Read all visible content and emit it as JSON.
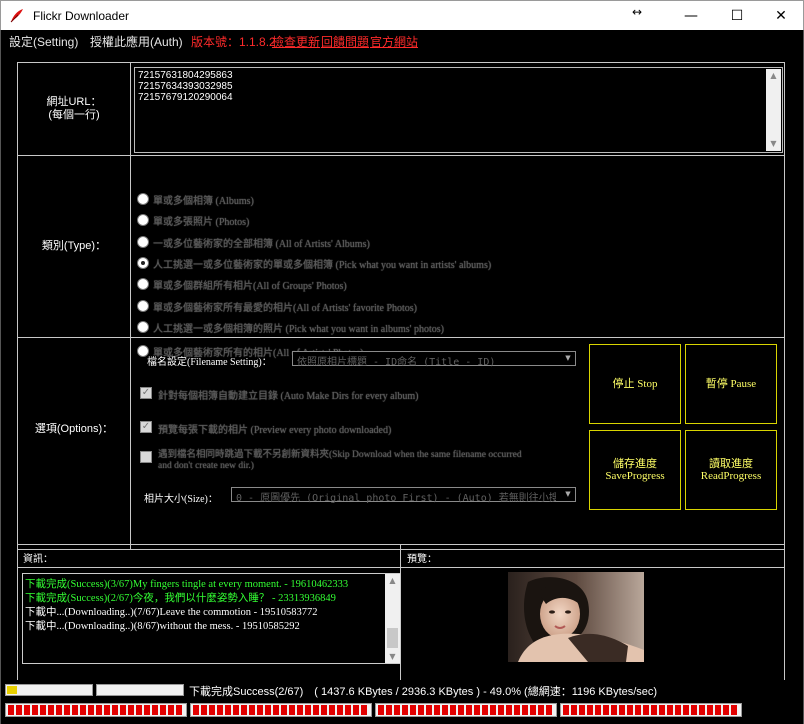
{
  "window": {
    "title": "Flickr Downloader",
    "minimize_glyph": "—",
    "maximize_glyph": "☐",
    "close_glyph": "✕",
    "resize_glyph": "↔"
  },
  "menu": {
    "settings": "設定(Setting)",
    "auth": "授權此應用(Auth)",
    "version": "版本號：1.1.8.2",
    "check_update": "檢查更新",
    "feedback": "回饋問題",
    "website": "官方網站"
  },
  "url_section": {
    "label_line1": "網址URL：",
    "label_line2": "(每個一行)",
    "value": "72157631804295863\n72157634393032985\n72157679120290064"
  },
  "type_section": {
    "label": "類別(Type)：",
    "options": [
      {
        "label": "單或多個相簿 (Albums)",
        "checked": false
      },
      {
        "label": "單或多張照片 (Photos)",
        "checked": false
      },
      {
        "label": "一或多位藝術家的全部相簿 (All of Artists' Albums)",
        "checked": false
      },
      {
        "label": "人工挑選一或多位藝術家的單或多個相簿 (Pick what you want in artists' albums)",
        "checked": true
      },
      {
        "label": "單或多個群組所有相片(All of Groups' Photos)",
        "checked": false
      },
      {
        "label": "單或多個藝術家所有最愛的相片(All of Artists' favorite Photos)",
        "checked": false
      },
      {
        "label": "人工挑選一或多個相簿的照片 (Pick what you want in albums' photos)",
        "checked": false
      },
      {
        "label": "單或多個藝術家所有的相片(All of Artists' Photos)",
        "checked": false
      }
    ]
  },
  "options_section": {
    "label": "選項(Options)：",
    "filename_label": "檔名設定(Filename Setting)：",
    "filename_value": "依照原相片標題 - ID命名 (Title - ID)",
    "auto_dir": {
      "label": "針對每個相簿自動建立目錄 (Auto Make Dirs for every album)",
      "checked": true
    },
    "preview": {
      "label": "預覽每張下載的相片 (Preview every photo downloaded)",
      "checked": true
    },
    "skip": {
      "label_line1": "遇到檔名相同時跳過下載不另創新資料夾(Skip Download when the same filename occurred",
      "label_line2": "and don't create new dir.)",
      "checked": false
    },
    "size_label": "相片大小(Size)：",
    "size_value": "0 - 原圖優先 (Original photo First) - (Auto) 若無則往小搜尋"
  },
  "buttons": {
    "stop": "停止 Stop",
    "pause": "暫停 Pause",
    "save_line1": "儲存進度",
    "save_line2": "SaveProgress",
    "read_line1": "讀取進度",
    "read_line2": "ReadProgress"
  },
  "info": {
    "label": "資訊：",
    "preview_label": "預覽：",
    "log": [
      {
        "text": "下載完成(Success)(3/67)My fingers tingle at every moment. - 19610462333",
        "color": "#33ff33"
      },
      {
        "text": "下載完成(Success)(2/67)今夜，我們以什麼姿勢入睡？ - 23313936849",
        "color": "#33ff33"
      },
      {
        "text": "下載中...(Downloading..)(7/67)Leave the commotion - 19510583772",
        "color": "#ffffff"
      },
      {
        "text": "下載中...(Downloading..)(8/67)without the mess. - 19510585292",
        "color": "#ffffff"
      }
    ]
  },
  "status": {
    "text": "下載完成Success(2/67)　( 1437.6 KBytes / 2936.3 KBytes ) - 49.0% (總網速：1196 KBytes/sec)",
    "overall_progress": 0.03,
    "album_progress": 0.0
  },
  "threads": [
    {
      "progress": 1.0
    },
    {
      "progress": 1.0
    },
    {
      "progress": 1.0
    },
    {
      "progress": 1.0
    }
  ],
  "colors": {
    "background": "#000000",
    "accent_red": "#ff2a2a",
    "button_yellow": "#ffff66",
    "success_green": "#33ff33",
    "thread_red": "#e10000"
  }
}
